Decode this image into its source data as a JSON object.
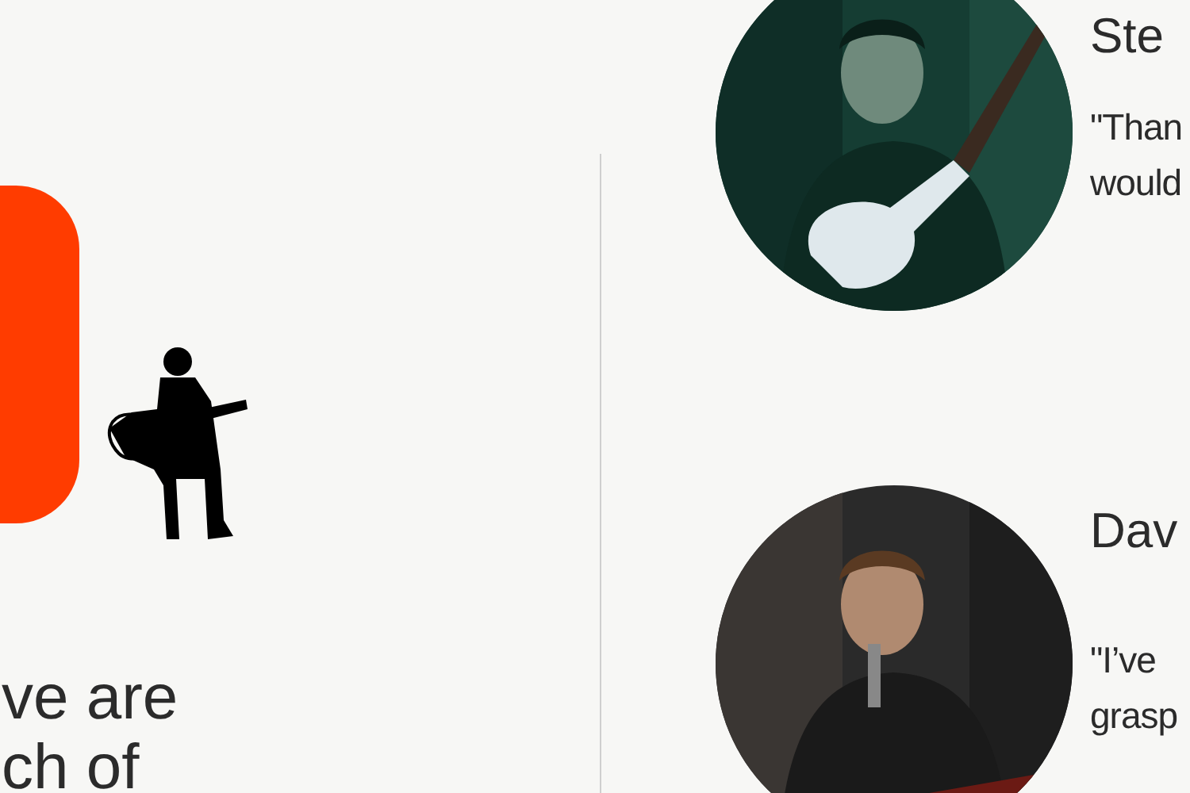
{
  "intro": {
    "lines": [
      "ve are",
      "ch of"
    ]
  },
  "testimonials": [
    {
      "name": "Ste",
      "quote_lines": [
        "\"Than",
        "would"
      ],
      "kind": "picture"
    },
    {
      "name": "Dav",
      "quote_lines": [
        "\"I’ve",
        "grasp"
      ],
      "kind": "picture"
    }
  ]
}
